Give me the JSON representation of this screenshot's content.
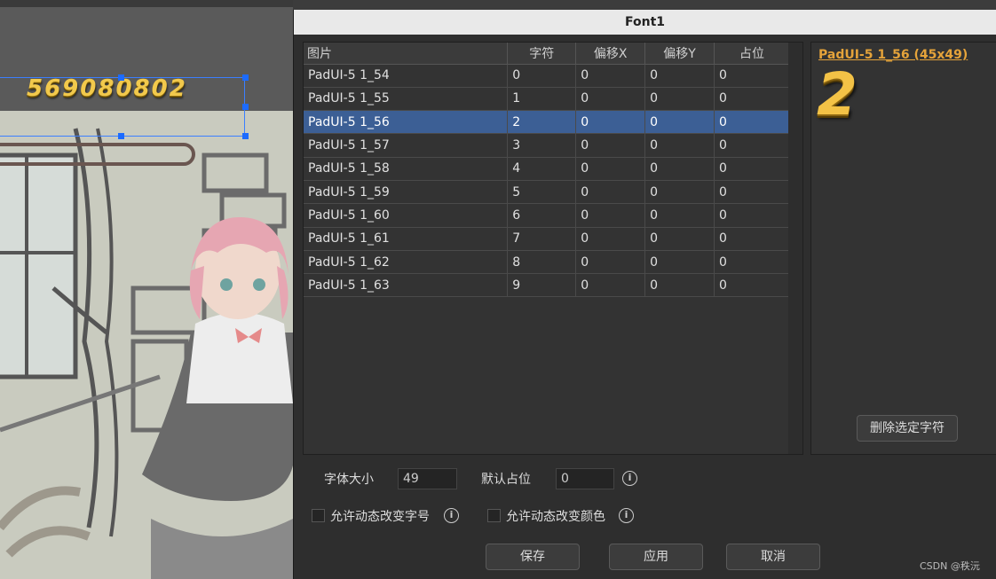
{
  "canvas": {
    "score_text": "569080802"
  },
  "dialog": {
    "title": "Font1",
    "table": {
      "headers": [
        "图片",
        "字符",
        "偏移X",
        "偏移Y",
        "占位"
      ],
      "rows": [
        [
          "PadUI-5 1_54",
          "0",
          "0",
          "0",
          "0"
        ],
        [
          "PadUI-5 1_55",
          "1",
          "0",
          "0",
          "0"
        ],
        [
          "PadUI-5 1_56",
          "2",
          "0",
          "0",
          "0"
        ],
        [
          "PadUI-5 1_57",
          "3",
          "0",
          "0",
          "0"
        ],
        [
          "PadUI-5 1_58",
          "4",
          "0",
          "0",
          "0"
        ],
        [
          "PadUI-5 1_59",
          "5",
          "0",
          "0",
          "0"
        ],
        [
          "PadUI-5 1_60",
          "6",
          "0",
          "0",
          "0"
        ],
        [
          "PadUI-5 1_61",
          "7",
          "0",
          "0",
          "0"
        ],
        [
          "PadUI-5 1_62",
          "8",
          "0",
          "0",
          "0"
        ],
        [
          "PadUI-5 1_63",
          "9",
          "0",
          "0",
          "0"
        ]
      ],
      "selected_row": 2
    },
    "preview": {
      "title": "PadUI-5 1_56 (45x49)",
      "glyph": "2",
      "delete_button": "删除选定字符"
    },
    "settings": {
      "font_size_label": "字体大小",
      "font_size_value": "49",
      "default_advance_label": "默认占位",
      "default_advance_value": "0",
      "info_icon": "i",
      "allow_dynamic_size_label": "允许动态改变字号",
      "allow_dynamic_color_label": "允许动态改变颜色"
    },
    "buttons": {
      "save": "保存",
      "apply": "应用",
      "cancel": "取消"
    }
  },
  "watermark": "CSDN @秩沅",
  "colors": {
    "selection": "#3c5f95",
    "preview_title": "#e5a33a",
    "glyph_gold": "#f3c246"
  }
}
